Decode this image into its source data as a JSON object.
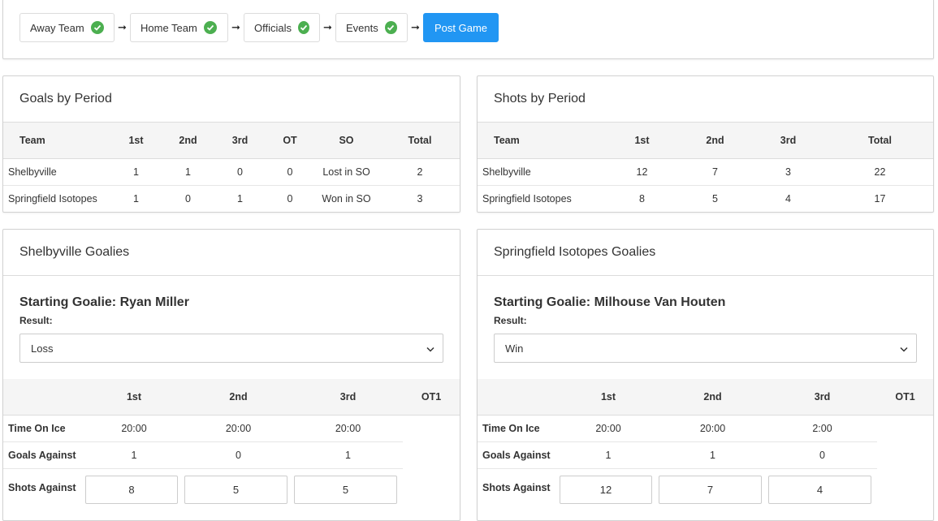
{
  "stepper": {
    "steps": [
      {
        "label": "Away Team",
        "done": true
      },
      {
        "label": "Home Team",
        "done": true
      },
      {
        "label": "Officials",
        "done": true
      },
      {
        "label": "Events",
        "done": true
      }
    ],
    "active_label": "Post Game",
    "arrow": "➞"
  },
  "goals": {
    "title": "Goals by Period",
    "headers": [
      "Team",
      "1st",
      "2nd",
      "3rd",
      "OT",
      "SO",
      "Total"
    ],
    "rows": [
      [
        "Shelbyville",
        "1",
        "1",
        "0",
        "0",
        "Lost in SO",
        "2"
      ],
      [
        "Springfield Isotopes",
        "1",
        "0",
        "1",
        "0",
        "Won in SO",
        "3"
      ]
    ]
  },
  "shots": {
    "title": "Shots by Period",
    "headers": [
      "Team",
      "1st",
      "2nd",
      "3rd",
      "Total"
    ],
    "rows": [
      [
        "Shelbyville",
        "12",
        "7",
        "3",
        "22"
      ],
      [
        "Springfield Isotopes",
        "8",
        "5",
        "4",
        "17"
      ]
    ]
  },
  "goalies": [
    {
      "title": "Shelbyville Goalies",
      "starting": "Starting Goalie: Ryan Miller",
      "result_label": "Result:",
      "result_value": "Loss",
      "headers": [
        "1st",
        "2nd",
        "3rd",
        "OT1"
      ],
      "time_label": "Time On Ice",
      "time": [
        "20:00",
        "20:00",
        "20:00"
      ],
      "goals_label": "Goals Against",
      "goals": [
        "1",
        "0",
        "1"
      ],
      "shots_label": "Shots Against",
      "shots": [
        "8",
        "5",
        "5"
      ]
    },
    {
      "title": "Springfield Isotopes Goalies",
      "starting": "Starting Goalie: Milhouse Van Houten",
      "result_label": "Result:",
      "result_value": "Win",
      "headers": [
        "1st",
        "2nd",
        "3rd",
        "OT1"
      ],
      "time_label": "Time On Ice",
      "time": [
        "20:00",
        "20:00",
        "2:00"
      ],
      "goals_label": "Goals Against",
      "goals": [
        "1",
        "1",
        "0"
      ],
      "shots_label": "Shots Against",
      "shots": [
        "12",
        "7",
        "4"
      ]
    }
  ],
  "colors": {
    "accent": "#2196f3",
    "check": "#4caf50"
  }
}
